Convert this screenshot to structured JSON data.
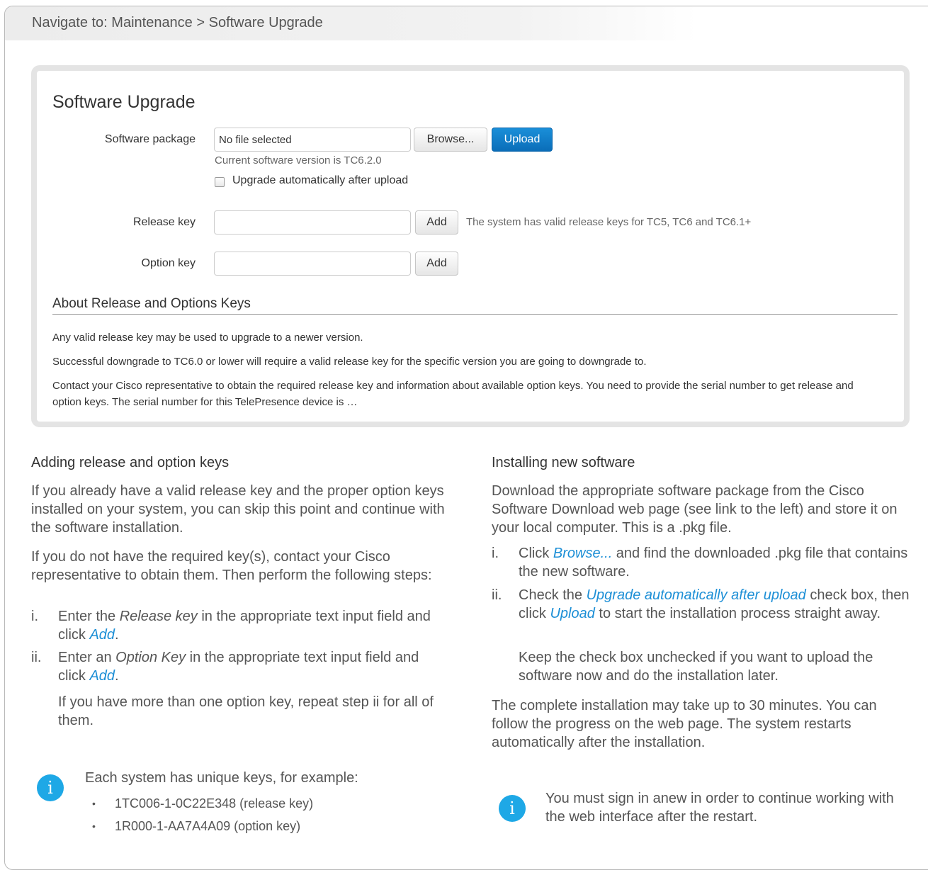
{
  "nav": {
    "text": "Navigate to: Maintenance > Software Upgrade"
  },
  "panel": {
    "title": "Software Upgrade",
    "software_package_label": "Software package",
    "file_field_value": "No file selected",
    "browse_label": "Browse...",
    "upload_label": "Upload",
    "current_version": "Current software version is TC6.2.0",
    "auto_upgrade_label": "Upgrade automatically after upload",
    "auto_upgrade_checked": false,
    "release_key_label": "Release key",
    "release_key_value": "",
    "release_add_label": "Add",
    "release_key_status": "The system has valid release keys for TC5, TC6 and TC6.1+",
    "option_key_label": "Option key",
    "option_key_value": "",
    "option_add_label": "Add",
    "about_heading": "About Release and Options Keys",
    "about_para1": "Any valid release key may be used to upgrade to a newer version.",
    "about_para2": "Successful downgrade to TC6.0 or lower will require a valid release key for the specific version you are going to downgrade to.",
    "about_para3": "Contact your Cisco representative to obtain the required release key and information about available option keys. You need to provide the serial number to get release and option keys. The serial number for this TelePresence device is …"
  },
  "left": {
    "heading": "Adding release and option keys",
    "para1": "If you already have a valid release key and the proper option keys installed on your system, you can skip this point and continue with the software installation.",
    "para2": "If you do not have the required key(s), contact your Cisco representative to obtain them. Then perform the following steps:",
    "step1": {
      "num": "i.",
      "pre": "Enter the ",
      "em": "Release key",
      "mid": " in the appropriate text input field and click ",
      "link": "Add",
      "post": "."
    },
    "step2": {
      "num": "ii.",
      "pre": "Enter an ",
      "em": "Option Key",
      "mid": " in the appropriate text input field and click ",
      "link": "Add",
      "post": "."
    },
    "step2_note": "If you have more than one option key, repeat step ii for all of them.",
    "info_intro": "Each system has unique keys, for example:",
    "info_bullets": [
      "1TC006-1-0C22E348 (release key)",
      "1R000-1-AA7A4A09 (option key)"
    ],
    "info_icon_glyph": "i"
  },
  "right": {
    "heading": "Installing new software",
    "para1": "Download the appropriate software package from the Cisco Software Download web page (see link to the left) and store it on your local computer. This is a .pkg file.",
    "step1": {
      "num": "i.",
      "pre": "Click ",
      "link": "Browse...",
      "post": " and find the downloaded .pkg file that contains the new software."
    },
    "step2": {
      "num": "ii.",
      "pre": "Check the ",
      "link1": "Upgrade automatically after upload",
      "mid": " check box, then click ",
      "link2": "Upload",
      "post": " to start the installation process straight away."
    },
    "step2_note": "Keep the check box unchecked if you want to upload the software now and do the installation later.",
    "para2": "The complete installation may take up to 30 minutes. You can follow the progress on the web page. The system restarts automatically after the installation.",
    "info_text": "You must sign in anew in order to continue working with the web interface after the restart.",
    "info_icon_glyph": "i"
  },
  "colors": {
    "accent": "#1d8fd6",
    "primary_button": "#0a6db8",
    "info_icon": "#1ea8e6"
  }
}
